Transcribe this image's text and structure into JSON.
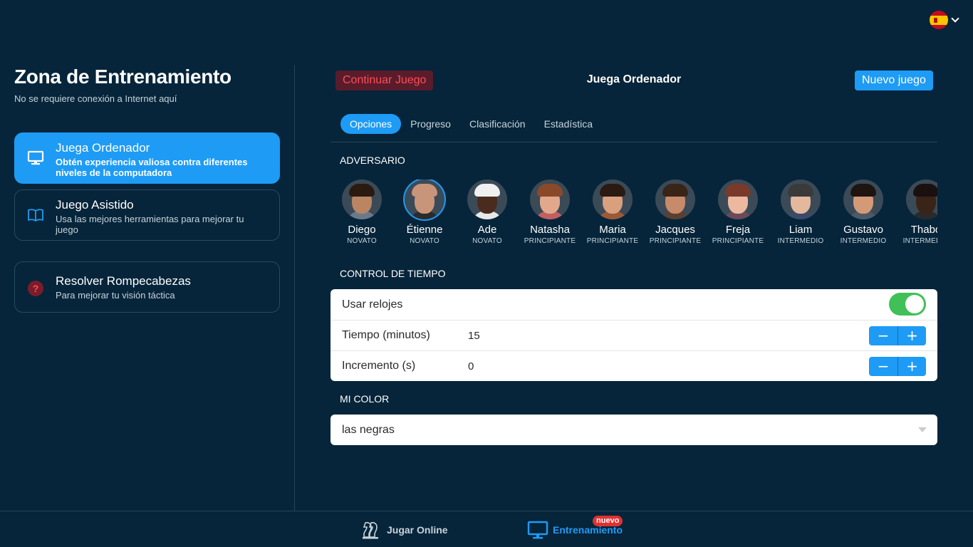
{
  "header": {
    "language_flag": "es-flag"
  },
  "left": {
    "title": "Zona de Entrenamiento",
    "subtitle": "No se requiere conexión a Internet aquí",
    "cards": [
      {
        "title": "Juega Ordenador",
        "desc": "Obtén experiencia valiosa contra diferentes niveles de la computadora",
        "icon": "monitor-icon",
        "active": true
      },
      {
        "title": "Juego Asistido",
        "desc": "Usa las mejores herramientas para mejorar tu juego",
        "icon": "book-icon"
      },
      {
        "title": "Resolver Rompecabezas",
        "desc": "Para mejorar tu visión táctica",
        "icon": "question-icon"
      }
    ]
  },
  "main": {
    "continue_label": "Continuar Juego",
    "title": "Juega Ordenador",
    "new_game_label": "Nuevo juego",
    "tabs": [
      "Opciones",
      "Progreso",
      "Clasificación",
      "Estadística"
    ],
    "active_tab": "Opciones",
    "opponent_heading": "ADVERSARIO",
    "opponents": [
      {
        "name": "Diego",
        "level": "NOVATO",
        "skin": "#b98563",
        "hair": "#2a1a10",
        "shirt": "#6b7a8a"
      },
      {
        "name": "Étienne",
        "level": "NOVATO",
        "skin": "#c9957a",
        "hair": "#c9957a",
        "shirt": "#2b2b2b",
        "selected": true
      },
      {
        "name": "Ade",
        "level": "NOVATO",
        "skin": "#4a2c1e",
        "hair": "#f0f0f0",
        "shirt": "#e8e8e8"
      },
      {
        "name": "Natasha",
        "level": "PRINCIPIANTE",
        "skin": "#e2a88c",
        "hair": "#8a4a2a",
        "shirt": "#c06060"
      },
      {
        "name": "Maria",
        "level": "PRINCIPIANTE",
        "skin": "#d9a07e",
        "hair": "#2a1a12",
        "shirt": "#9a5a3a"
      },
      {
        "name": "Jacques",
        "level": "PRINCIPIANTE",
        "skin": "#c78a6a",
        "hair": "#3a2418",
        "shirt": "#5a4030"
      },
      {
        "name": "Freja",
        "level": "PRINCIPIANTE",
        "skin": "#ecb8a0",
        "hair": "#7a3a2a",
        "shirt": "#6a4a5a"
      },
      {
        "name": "Liam",
        "level": "INTERMEDIO",
        "skin": "#e4b89c",
        "hair": "#3a3a3a",
        "shirt": "#3a4a6a"
      },
      {
        "name": "Gustavo",
        "level": "INTERMEDIO",
        "skin": "#d49a78",
        "hair": "#1e1410",
        "shirt": "#4a5a6a"
      },
      {
        "name": "Thabo",
        "level": "INTERMEDIO",
        "skin": "#3a2418",
        "hair": "#1a1010",
        "shirt": "#2a2a2a"
      }
    ],
    "time_heading": "CONTROL DE TIEMPO",
    "time": {
      "use_clocks_label": "Usar relojes",
      "use_clocks_on": true,
      "minutes_label": "Tiempo (minutos)",
      "minutes_value": "15",
      "increment_label": "Incremento (s)",
      "increment_value": "0",
      "minus": "−",
      "plus": "+"
    },
    "color_heading": "MI COLOR",
    "color_value": "las negras"
  },
  "bottom_nav": {
    "online_label": "Jugar Online",
    "training_label": "Entrenamiento",
    "badge": "nuevo"
  },
  "colors": {
    "accent": "#1e9bf5",
    "background": "#06253a",
    "danger": "#ff4b57",
    "toggle_on": "#40c057"
  }
}
